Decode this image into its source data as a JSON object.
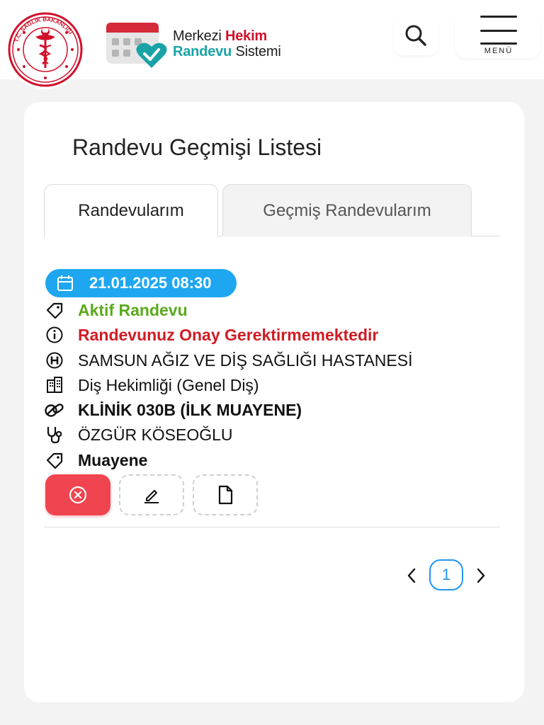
{
  "header": {
    "seal_text": "T.C. SAĞLIK BAKANLIĞI",
    "brand": {
      "word1": "Merkezi",
      "word2": "Hekim",
      "word3": "Randevu",
      "word4": "Sistemi"
    },
    "menu_label": "MENÜ"
  },
  "page": {
    "title": "Randevu Geçmişi Listesi"
  },
  "tabs": [
    {
      "label": "Randevularım",
      "active": true
    },
    {
      "label": "Geçmiş Randevularım",
      "active": false
    }
  ],
  "appointment": {
    "datetime": "21.01.2025 08:30",
    "status": "Aktif Randevu",
    "notice": "Randevunuz Onay Gerektirmemektedir",
    "hospital": "SAMSUN AĞIZ VE DİŞ SAĞLIĞI HASTANESİ",
    "department": "Diş Hekimliği (Genel Diş)",
    "clinic": "KLİNİK 030B (İLK MUAYENE)",
    "doctor": "ÖZGÜR KÖSEOĞLU",
    "type": "Muayene"
  },
  "pagination": {
    "current": "1"
  },
  "colors": {
    "accent_blue": "#1ea7f0",
    "status_green": "#5aa91b",
    "notice_red": "#d01c24",
    "cancel_red": "#f04550",
    "brand_red": "#d0112b",
    "brand_teal": "#1aa3a6"
  }
}
